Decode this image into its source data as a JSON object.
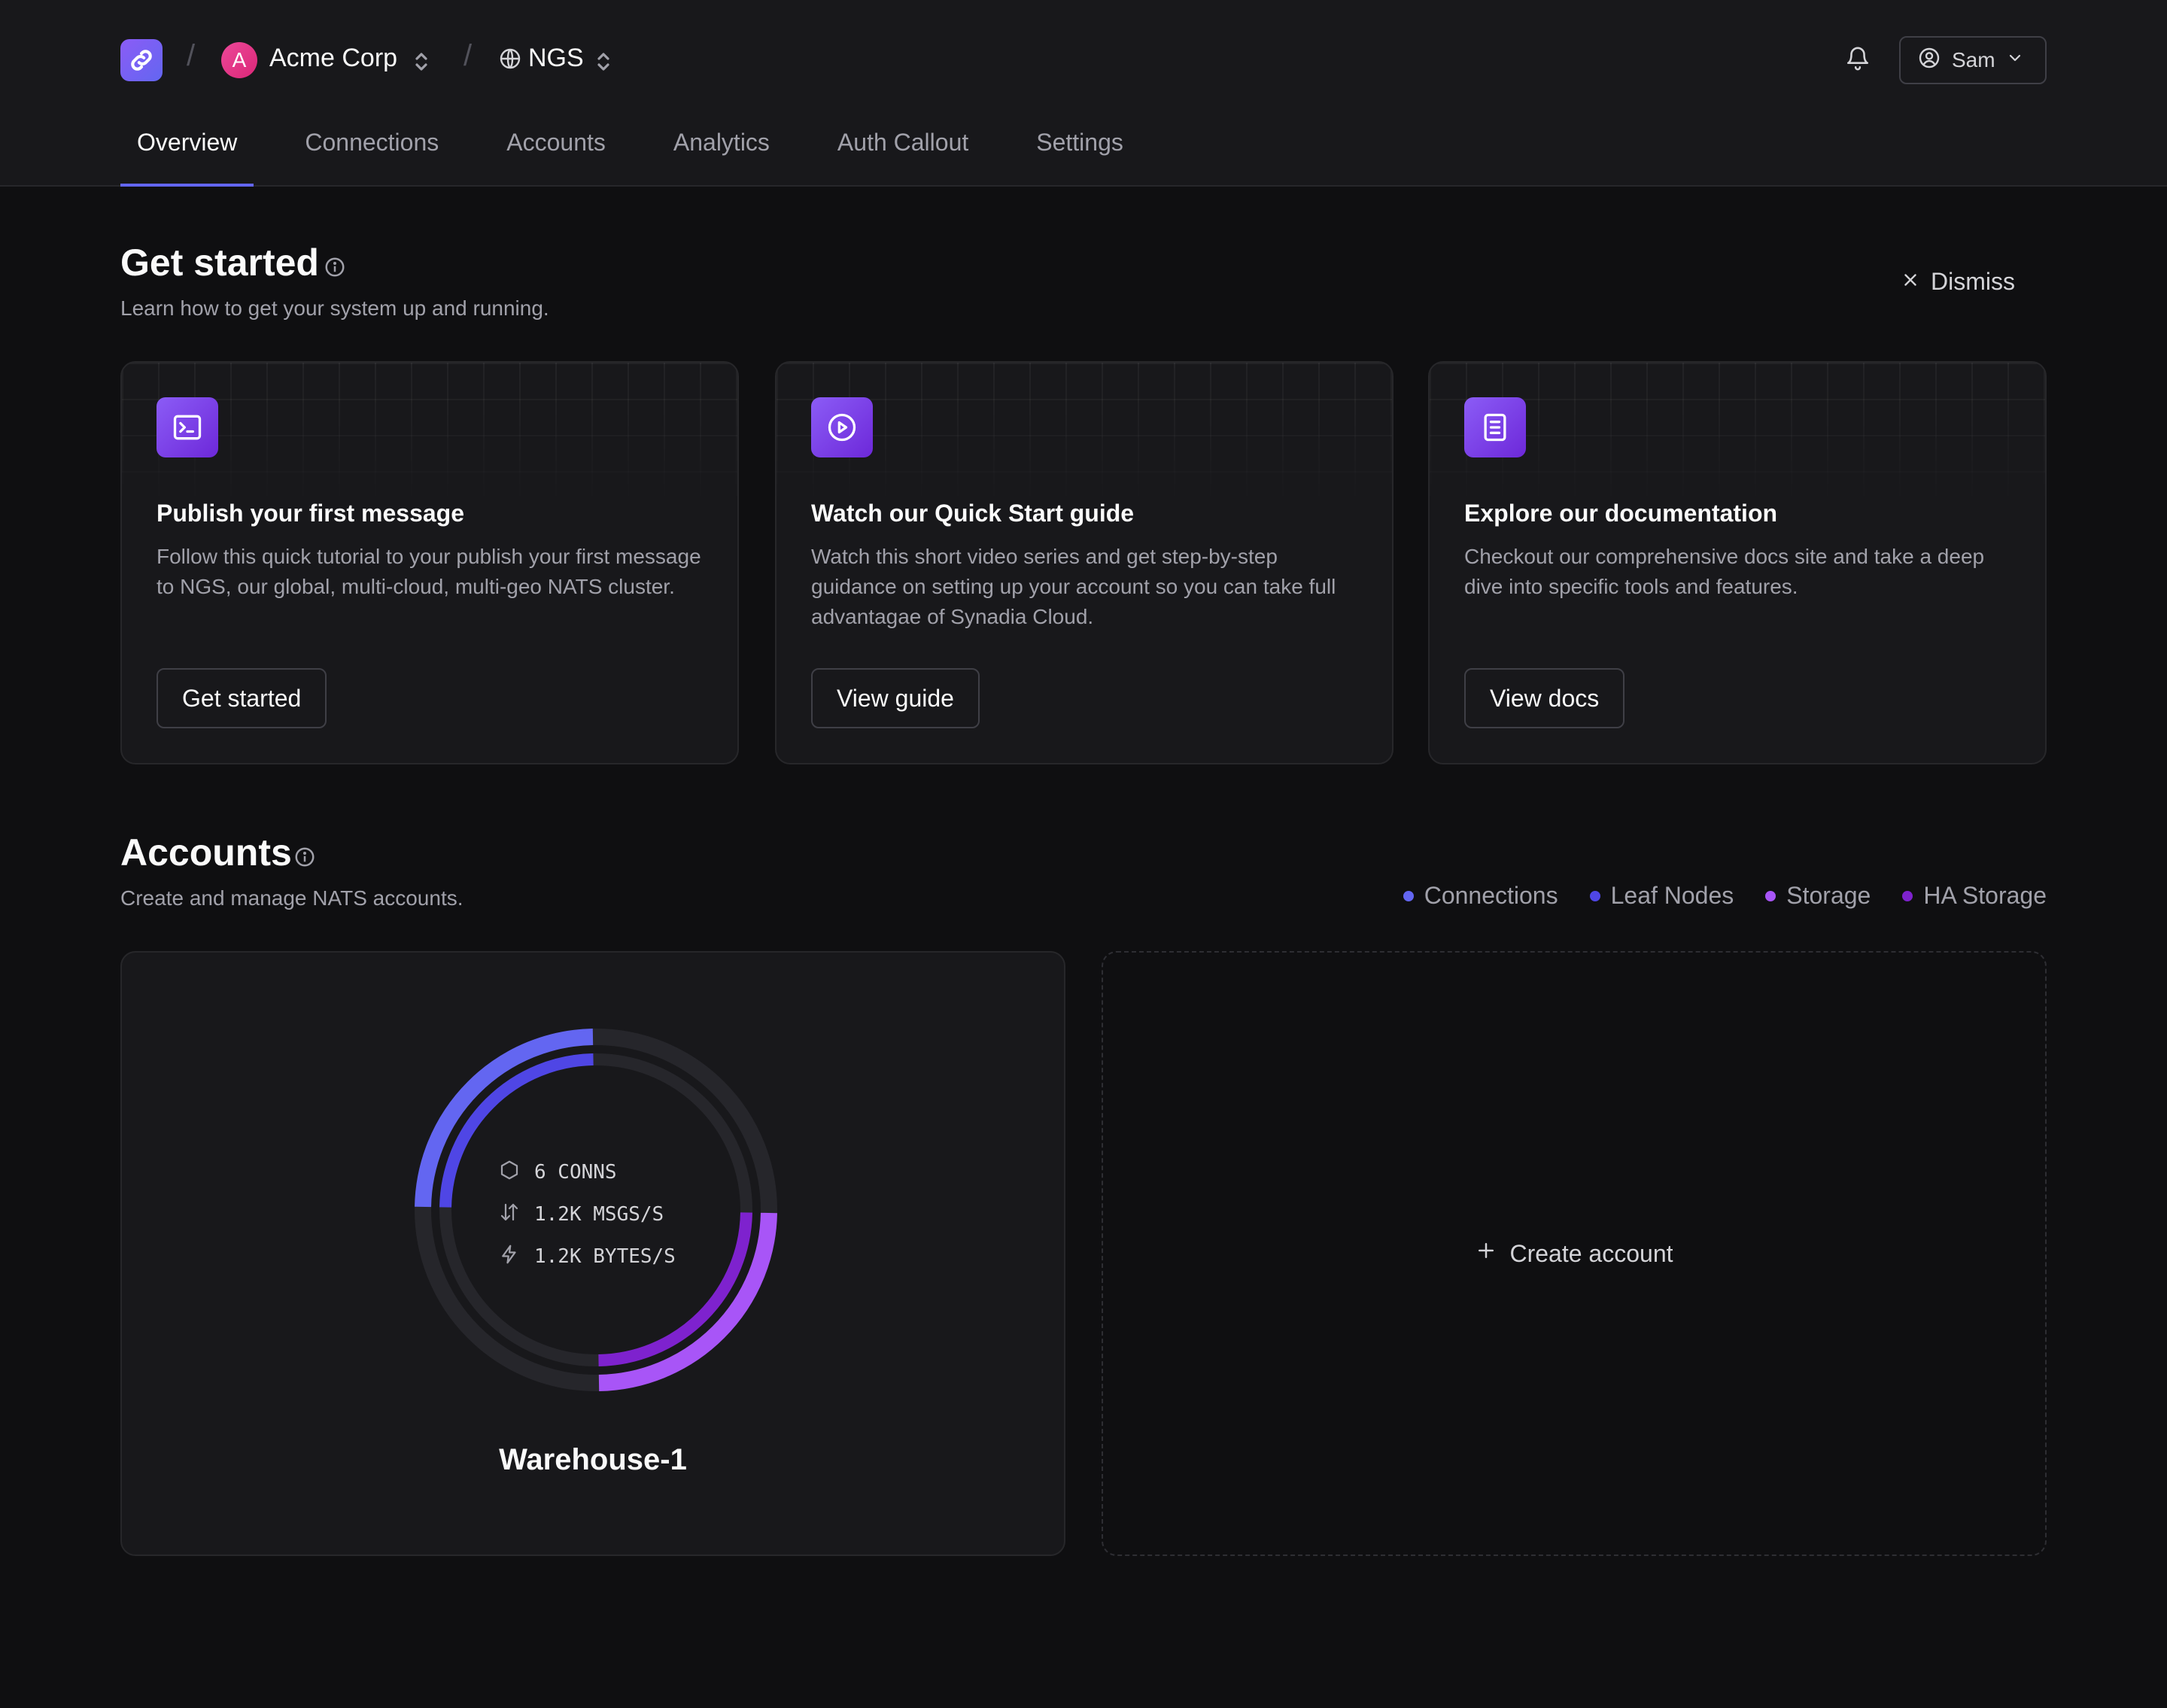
{
  "header": {
    "org": {
      "initial": "A",
      "name": "Acme Corp"
    },
    "system": {
      "name": "NGS"
    },
    "user": {
      "name": "Sam"
    }
  },
  "tabs": [
    {
      "label": "Overview",
      "active": true
    },
    {
      "label": "Connections",
      "active": false
    },
    {
      "label": "Accounts",
      "active": false
    },
    {
      "label": "Analytics",
      "active": false
    },
    {
      "label": "Auth Callout",
      "active": false
    },
    {
      "label": "Settings",
      "active": false
    }
  ],
  "get_started": {
    "title": "Get started",
    "subtitle": "Learn how to get your system up and running.",
    "dismiss_label": "Dismiss",
    "cards": [
      {
        "icon": "terminal-icon",
        "title": "Publish your first message",
        "description": "Follow this quick tutorial to your publish your first message to NGS, our global, multi-cloud, multi-geo NATS cluster.",
        "button": "Get started"
      },
      {
        "icon": "play-circle-icon",
        "title": "Watch our Quick Start guide",
        "description": "Watch this short video series and get step-by-step guidance on setting up your account so you can take full advantagae of Synadia Cloud.",
        "button": "View guide"
      },
      {
        "icon": "document-icon",
        "title": "Explore our documentation",
        "description": "Checkout our comprehensive docs site and take a deep dive into specific tools and features.",
        "button": "View docs"
      }
    ]
  },
  "accounts": {
    "title": "Accounts",
    "subtitle": "Create and manage NATS accounts.",
    "legend": [
      {
        "label": "Connections",
        "color": "#6366f1"
      },
      {
        "label": "Leaf Nodes",
        "color": "#4f46e5"
      },
      {
        "label": "Storage",
        "color": "#a855f7"
      },
      {
        "label": "HA Storage",
        "color": "#7e22ce"
      }
    ],
    "items": [
      {
        "name": "Warehouse-1",
        "stats": {
          "conns": "6 CONNS",
          "msgs": "1.2K MSGS/S",
          "bytes": "1.2K BYTES/S"
        },
        "usage": {
          "connections": 0.25,
          "leaf_nodes": 0.25,
          "storage": 0.25,
          "ha_storage": 0.25
        }
      }
    ],
    "create_label": "Create account"
  },
  "colors": {
    "accent": "#6366f1",
    "background": "#0f0f11",
    "surface": "#18181b"
  }
}
